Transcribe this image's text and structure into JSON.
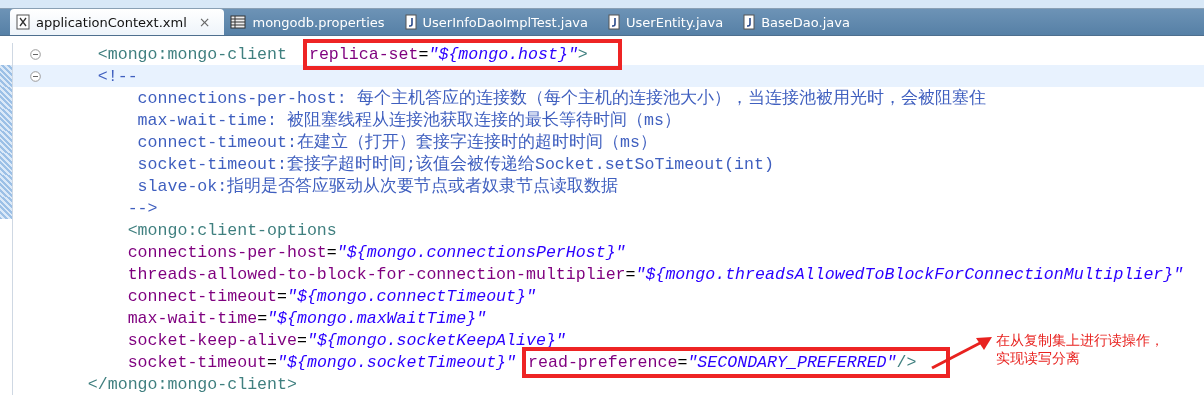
{
  "tabs": [
    {
      "label": "applicationContext.xml",
      "kind": "xml",
      "selected": true,
      "close": "×"
    },
    {
      "label": "mongodb.properties",
      "kind": "properties",
      "selected": false
    },
    {
      "label": "UserInfoDaoImplTest.java",
      "kind": "java",
      "selected": false
    },
    {
      "label": "UserEntity.java",
      "kind": "java",
      "selected": false
    },
    {
      "label": "BaseDao.java",
      "kind": "java",
      "selected": false
    }
  ],
  "lines": [
    {
      "foldable": true,
      "marked": false,
      "current": false,
      "segments": [
        {
          "kind": "tag",
          "text": "     <mongo:mongo-client "
        }
      ],
      "highlight": [
        {
          "kind": "attr",
          "text": "replica-set"
        },
        {
          "kind": "eq",
          "text": "="
        },
        {
          "kind": "value",
          "text": "\"${mongo.host}\""
        },
        {
          "kind": "tag",
          "text": ">"
        }
      ]
    },
    {
      "foldable": true,
      "marked": true,
      "current": true,
      "segments": [
        {
          "kind": "comment",
          "text": "     <!--"
        }
      ]
    },
    {
      "foldable": false,
      "marked": true,
      "current": false,
      "segments": [
        {
          "kind": "comment",
          "text": "         connections-per-host: 每个主机答应的连接数（每个主机的连接池大小），当连接池被用光时，会被阻塞住"
        }
      ]
    },
    {
      "foldable": false,
      "marked": true,
      "current": false,
      "segments": [
        {
          "kind": "comment",
          "text": "         max-wait-time: 被阻塞线程从连接池获取连接的最长等待时间（ms）"
        }
      ]
    },
    {
      "foldable": false,
      "marked": true,
      "current": false,
      "segments": [
        {
          "kind": "comment",
          "text": "         connect-timeout:在建立（打开）套接字连接时的超时时间（ms）"
        }
      ]
    },
    {
      "foldable": false,
      "marked": true,
      "current": false,
      "segments": [
        {
          "kind": "comment",
          "text": "         socket-timeout:套接字超时时间;该值会被传递给Socket.setSoTimeout(int)"
        }
      ]
    },
    {
      "foldable": false,
      "marked": true,
      "current": false,
      "segments": [
        {
          "kind": "comment",
          "text": "         slave-ok:指明是否答应驱动从次要节点或者奴隶节点读取数据"
        }
      ]
    },
    {
      "foldable": false,
      "marked": true,
      "current": false,
      "segments": [
        {
          "kind": "comment",
          "text": "        -->"
        }
      ]
    },
    {
      "foldable": false,
      "marked": false,
      "current": false,
      "segments": [
        {
          "kind": "tag",
          "text": "        <mongo:client-options"
        }
      ]
    },
    {
      "foldable": false,
      "marked": false,
      "current": false,
      "segments": [
        {
          "kind": "attr",
          "text": "        connections-per-host"
        },
        {
          "kind": "eq",
          "text": "="
        },
        {
          "kind": "value",
          "text": "\"${mongo.connectionsPerHost}\""
        }
      ]
    },
    {
      "foldable": false,
      "marked": false,
      "current": false,
      "segments": [
        {
          "kind": "attr",
          "text": "        threads-allowed-to-block-for-connection-multiplier"
        },
        {
          "kind": "eq",
          "text": "="
        },
        {
          "kind": "value",
          "text": "\"${mongo.threadsAllowedToBlockForConnectionMultiplier}\""
        }
      ]
    },
    {
      "foldable": false,
      "marked": false,
      "current": false,
      "segments": [
        {
          "kind": "attr",
          "text": "        connect-timeout"
        },
        {
          "kind": "eq",
          "text": "="
        },
        {
          "kind": "value",
          "text": "\"${mongo.connectTimeout}\""
        }
      ]
    },
    {
      "foldable": false,
      "marked": false,
      "current": false,
      "segments": [
        {
          "kind": "attr",
          "text": "        max-wait-time"
        },
        {
          "kind": "eq",
          "text": "="
        },
        {
          "kind": "value",
          "text": "\"${mongo.maxWaitTime}\""
        }
      ]
    },
    {
      "foldable": false,
      "marked": false,
      "current": false,
      "segments": [
        {
          "kind": "attr",
          "text": "        socket-keep-alive"
        },
        {
          "kind": "eq",
          "text": "="
        },
        {
          "kind": "value",
          "text": "\"${mongo.socketKeepAlive}\""
        }
      ]
    },
    {
      "foldable": false,
      "marked": false,
      "current": false,
      "segments": [
        {
          "kind": "attr",
          "text": "        socket-timeout"
        },
        {
          "kind": "eq",
          "text": "="
        },
        {
          "kind": "value",
          "text": "\"${mongo.socketTimeout}\""
        }
      ],
      "highlight": [
        {
          "kind": "attr",
          "text": "read-preference"
        },
        {
          "kind": "eq",
          "text": "="
        },
        {
          "kind": "value",
          "text": "\"SECONDARY_PREFERRED\""
        },
        {
          "kind": "tag",
          "text": "/>"
        }
      ]
    },
    {
      "foldable": false,
      "marked": false,
      "current": false,
      "segments": [
        {
          "kind": "tag",
          "text": "    </mongo:mongo-client>"
        }
      ]
    }
  ],
  "callout": {
    "lines": [
      "在从复制集上进行读操作，",
      "实现读写分离"
    ]
  }
}
